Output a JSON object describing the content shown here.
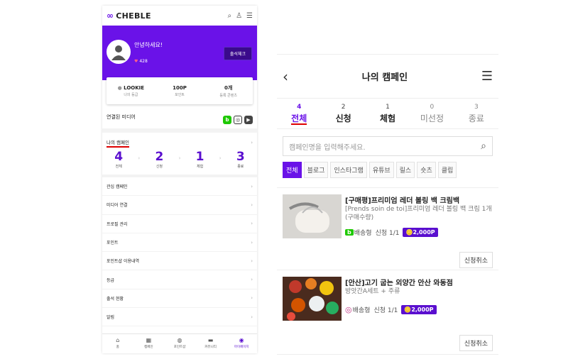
{
  "left": {
    "brand": "CHEBLE",
    "greeting": "안녕하세요!",
    "hearts": "428",
    "attend_button": "출석체크",
    "stats": [
      {
        "value": "LOOKIE",
        "label": "나의 등급"
      },
      {
        "value": "100P",
        "label": "포인트"
      },
      {
        "value": "0개",
        "label": "등록 콘텐츠"
      }
    ],
    "linked_media": "연결된 미디어",
    "my_campaign": "나의 캠페인",
    "counts": [
      {
        "n": "4",
        "l": "전체"
      },
      {
        "n": "2",
        "l": "신청"
      },
      {
        "n": "1",
        "l": "체험"
      },
      {
        "n": "3",
        "l": "종료"
      }
    ],
    "menu": [
      "관심 캠페인",
      "미디어 연결",
      "프로필 관리",
      "포인트",
      "포인트샵 이용내역",
      "등급",
      "출석 현황",
      "알림"
    ],
    "bottom_nav": [
      "홈",
      "캠페인",
      "포인트샵",
      "커뮤니티",
      "마이페이지"
    ]
  },
  "right": {
    "title": "나의 캠페인",
    "tabs": [
      {
        "n": "4",
        "l": "전체"
      },
      {
        "n": "2",
        "l": "신청"
      },
      {
        "n": "1",
        "l": "체험"
      },
      {
        "n": "0",
        "l": "미선정"
      },
      {
        "n": "3",
        "l": "종료"
      }
    ],
    "search_placeholder": "캠페인명을 입력해주세요.",
    "chips": [
      "전체",
      "블로그",
      "인스타그램",
      "유튜브",
      "릴스",
      "숏츠",
      "클립"
    ],
    "cards": [
      {
        "title": "[구매평]프리미엄 레더 볼링 백 크림백",
        "sub": "[Prends soin de toi]프리미엄 레더 볼링 백 크림 1개 (구매수량)",
        "type": "배송형",
        "apply": "신청 1/1",
        "points": "2,000P",
        "cancel": "신청취소"
      },
      {
        "title": "[안산]고기 굽는 외양간 안산 와동점",
        "sub": "방앗간A세트 + 주류",
        "type": "배송형",
        "apply": "신청 1/1",
        "points": "2,000P",
        "cancel": "신청취소"
      }
    ]
  },
  "colors": {
    "brand": "#6a12e8",
    "badge": "#5a0fcf"
  }
}
